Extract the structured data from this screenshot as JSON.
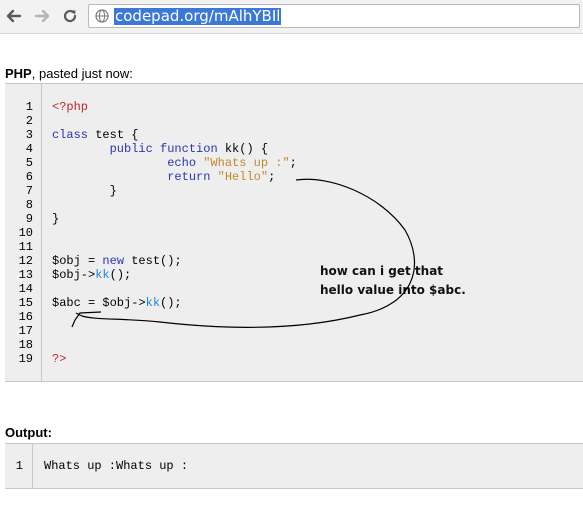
{
  "browser": {
    "url": "codepad.org/mAlhYBIl",
    "icons": [
      "back-arrow-icon",
      "forward-arrow-icon",
      "reload-icon",
      "globe-icon"
    ]
  },
  "paste": {
    "language": "PHP",
    "meta": ", pasted just now:",
    "lines": [
      {
        "n": "1",
        "tokens": [
          {
            "t": "<?php",
            "c": "tag"
          }
        ]
      },
      {
        "n": "2",
        "tokens": []
      },
      {
        "n": "3",
        "tokens": [
          {
            "t": "class",
            "c": "kw"
          },
          {
            "t": " test {",
            "c": "plain"
          }
        ]
      },
      {
        "n": "4",
        "tokens": [
          {
            "t": "        ",
            "c": "plain"
          },
          {
            "t": "public",
            "c": "kw"
          },
          {
            "t": " ",
            "c": "plain"
          },
          {
            "t": "function",
            "c": "kw"
          },
          {
            "t": " kk() {",
            "c": "plain"
          }
        ]
      },
      {
        "n": "5",
        "tokens": [
          {
            "t": "                ",
            "c": "plain"
          },
          {
            "t": "echo",
            "c": "kw"
          },
          {
            "t": " ",
            "c": "plain"
          },
          {
            "t": "\"Whats up :\"",
            "c": "str"
          },
          {
            "t": ";",
            "c": "plain"
          }
        ]
      },
      {
        "n": "6",
        "tokens": [
          {
            "t": "                ",
            "c": "plain"
          },
          {
            "t": "return",
            "c": "kw"
          },
          {
            "t": " ",
            "c": "plain"
          },
          {
            "t": "\"Hello\"",
            "c": "str"
          },
          {
            "t": ";",
            "c": "plain"
          }
        ]
      },
      {
        "n": "7",
        "tokens": [
          {
            "t": "        }",
            "c": "plain"
          }
        ]
      },
      {
        "n": "8",
        "tokens": []
      },
      {
        "n": "9",
        "tokens": [
          {
            "t": "}",
            "c": "plain"
          }
        ]
      },
      {
        "n": "10",
        "tokens": []
      },
      {
        "n": "11",
        "tokens": []
      },
      {
        "n": "12",
        "tokens": [
          {
            "t": "$obj = ",
            "c": "plain"
          },
          {
            "t": "new",
            "c": "kw"
          },
          {
            "t": " test();",
            "c": "plain"
          }
        ]
      },
      {
        "n": "13",
        "tokens": [
          {
            "t": "$obj->",
            "c": "plain"
          },
          {
            "t": "kk",
            "c": "fn"
          },
          {
            "t": "();",
            "c": "plain"
          }
        ]
      },
      {
        "n": "14",
        "tokens": []
      },
      {
        "n": "15",
        "tokens": [
          {
            "t": "$abc = $obj->",
            "c": "plain"
          },
          {
            "t": "kk",
            "c": "fn"
          },
          {
            "t": "();",
            "c": "plain"
          }
        ]
      },
      {
        "n": "16",
        "tokens": []
      },
      {
        "n": "17",
        "tokens": []
      },
      {
        "n": "18",
        "tokens": []
      },
      {
        "n": "19",
        "tokens": [
          {
            "t": "?>",
            "c": "tag"
          }
        ]
      }
    ]
  },
  "annotation": {
    "line1": "how can i get that",
    "line2": "hello value into $abc."
  },
  "output": {
    "title": "Output:",
    "lines": [
      {
        "n": "1",
        "text": "Whats up :Whats up :"
      }
    ]
  }
}
